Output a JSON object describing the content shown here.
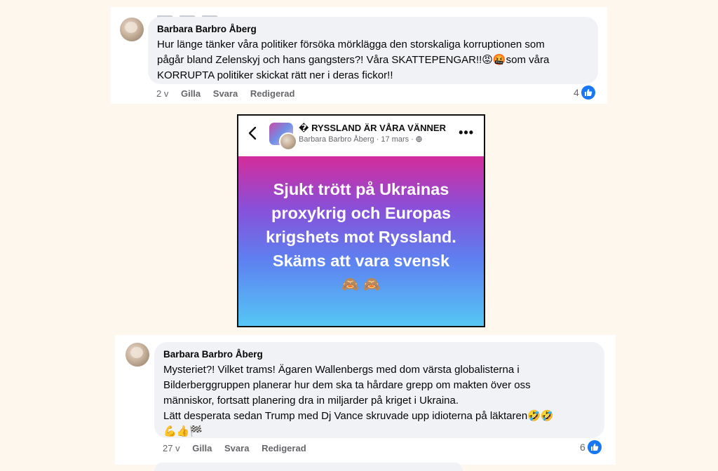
{
  "comment1": {
    "author": "Barbara Barbro Åberg",
    "lines": [
      "Hur länge tänker våra politiker försöka mörklägga den storskaliga korruptionen som",
      "pågår bland Zelenskyj och hans gangsters?! Våra SKATTEPENGAR!!",
      "som våra",
      "KORRUPTA politiker skickat rätt ner i deras fickor!!"
    ],
    "emoji_inline": "😡🤬",
    "time": "2 v",
    "like": "Gilla",
    "reply": "Svara",
    "edited": "Redigerad",
    "reaction_count": "4"
  },
  "post": {
    "group_name": "� RYSSLAND ÄR VÅRA VÄNNER",
    "author": "Barbara Barbro Åberg",
    "date": "17 mars",
    "lines": [
      "Sjukt trött på Ukrainas",
      "proxykrig och Europas",
      "krigshets mot Ryssland.",
      "Skäms att vara svensk"
    ],
    "emoji": "🙈 🙈",
    "back_icon": "chevron-left-icon",
    "more_icon": "more-dots-icon"
  },
  "comment2": {
    "author": "Barbara Barbro Åberg",
    "lines": [
      "Mysteriet?! Vilket trams! Ägaren Wallenbergs med dom värsta globalisterna i",
      "Bilderberggruppen planerar hur dem ska ta hårdare grepp om makten över oss",
      "människor, fortsatt planering dra in miljarder på kriget i Ukraina.",
      "Lätt desperata sedan Trump med Dj Vance skruvade upp idioterna på läktaren"
    ],
    "line4_emoji": "🤣🤣",
    "line5_emoji": "💪👍🏁",
    "time": "27 v",
    "like": "Gilla",
    "reply": "Svara",
    "edited": "Redigerad",
    "reaction_count": "6"
  },
  "colors": {
    "background": "#fdf7ee",
    "bubble": "#f0f2f5",
    "like_blue": "#1877f2",
    "muted_text": "#65676b"
  }
}
